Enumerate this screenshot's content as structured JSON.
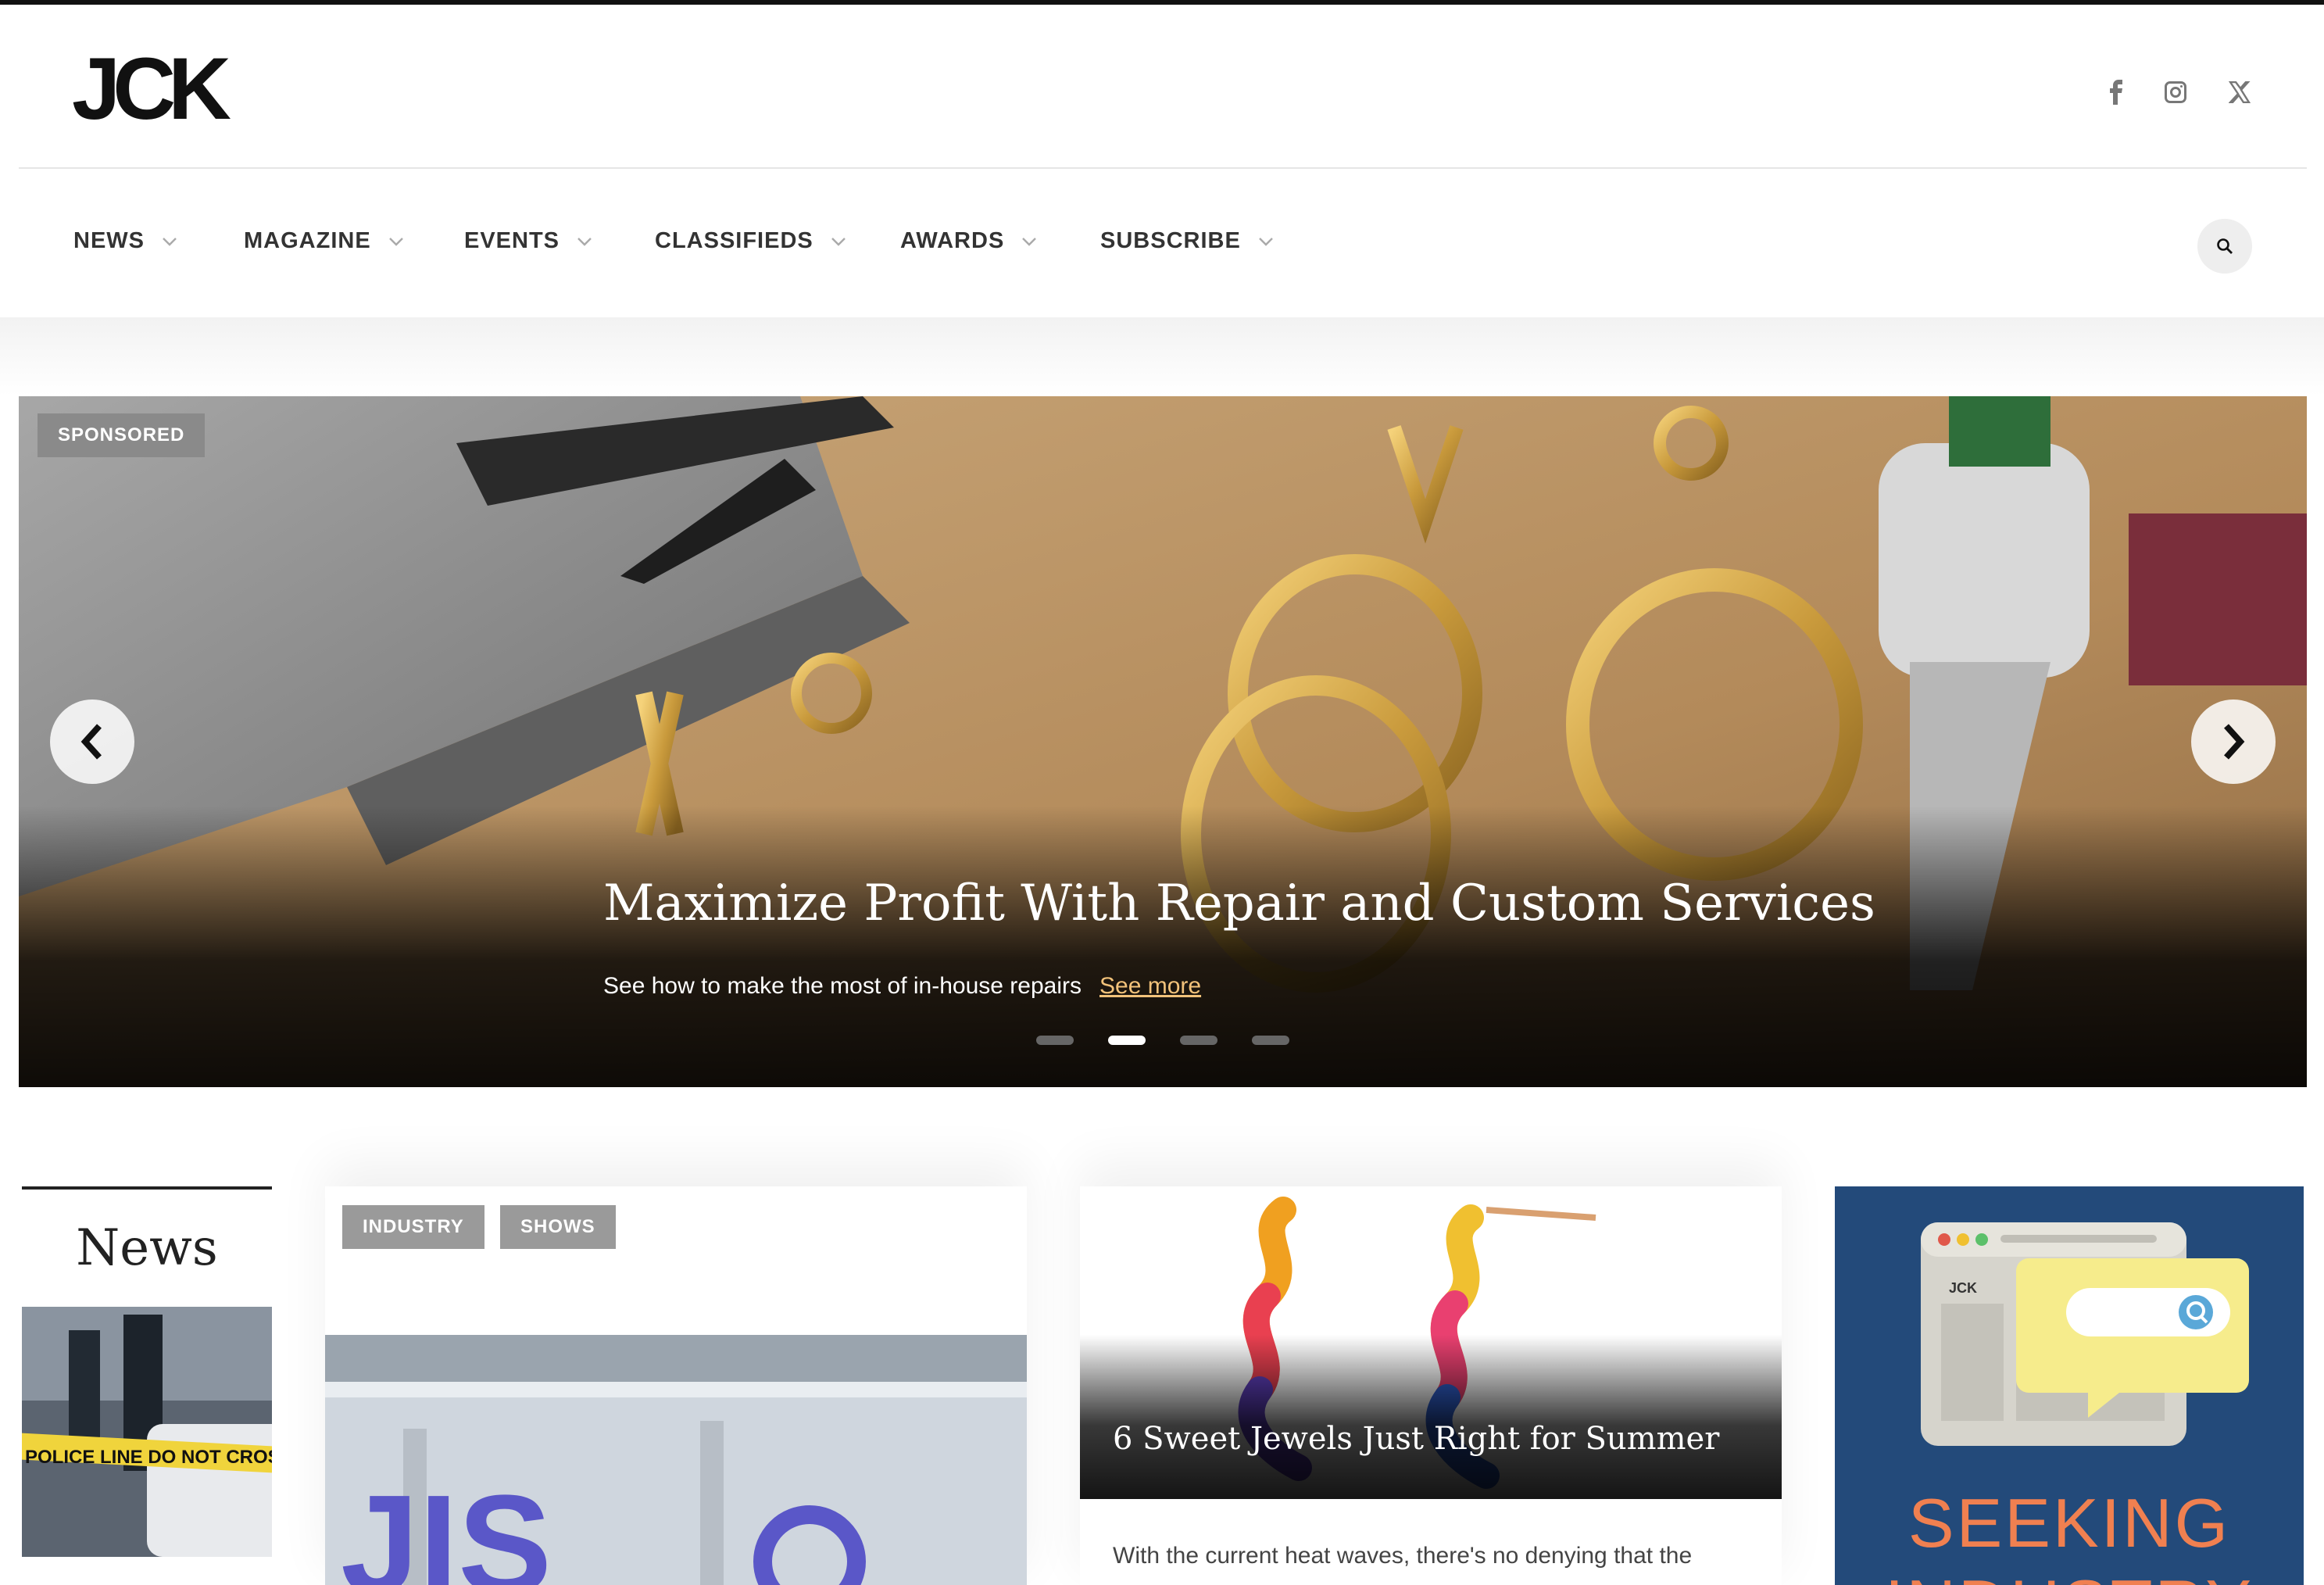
{
  "header": {
    "logo_text": "JCK",
    "social": [
      "facebook-icon",
      "instagram-icon",
      "x-icon"
    ]
  },
  "nav": {
    "items": [
      {
        "label": "NEWS"
      },
      {
        "label": "MAGAZINE"
      },
      {
        "label": "EVENTS"
      },
      {
        "label": "CLASSIFIEDS"
      },
      {
        "label": "AWARDS"
      },
      {
        "label": "SUBSCRIBE"
      }
    ],
    "search_icon": "search-icon"
  },
  "hero": {
    "badge": "SPONSORED",
    "title": "Maximize Profit With Repair and Custom Services",
    "subtitle": "See how to make the most of in-house repairs",
    "link": "See more",
    "slide_count": 4,
    "active_slide": 2
  },
  "news": {
    "heading": "News"
  },
  "cards": {
    "card1": {
      "tags": [
        "INDUSTRY",
        "SHOWS"
      ],
      "image_text": "JIS"
    },
    "card2": {
      "title": "6 Sweet Jewels Just Right for Summer",
      "excerpt": "With the current heat waves, there's no denying that the"
    }
  },
  "ad": {
    "small_logo": "JCK",
    "headline_line1": "SEEKING",
    "headline_line2": "INDUSTRY"
  },
  "colors": {
    "accent_link": "#f2c27a",
    "ad_bg": "#234a7a",
    "ad_text": "#f08050"
  }
}
